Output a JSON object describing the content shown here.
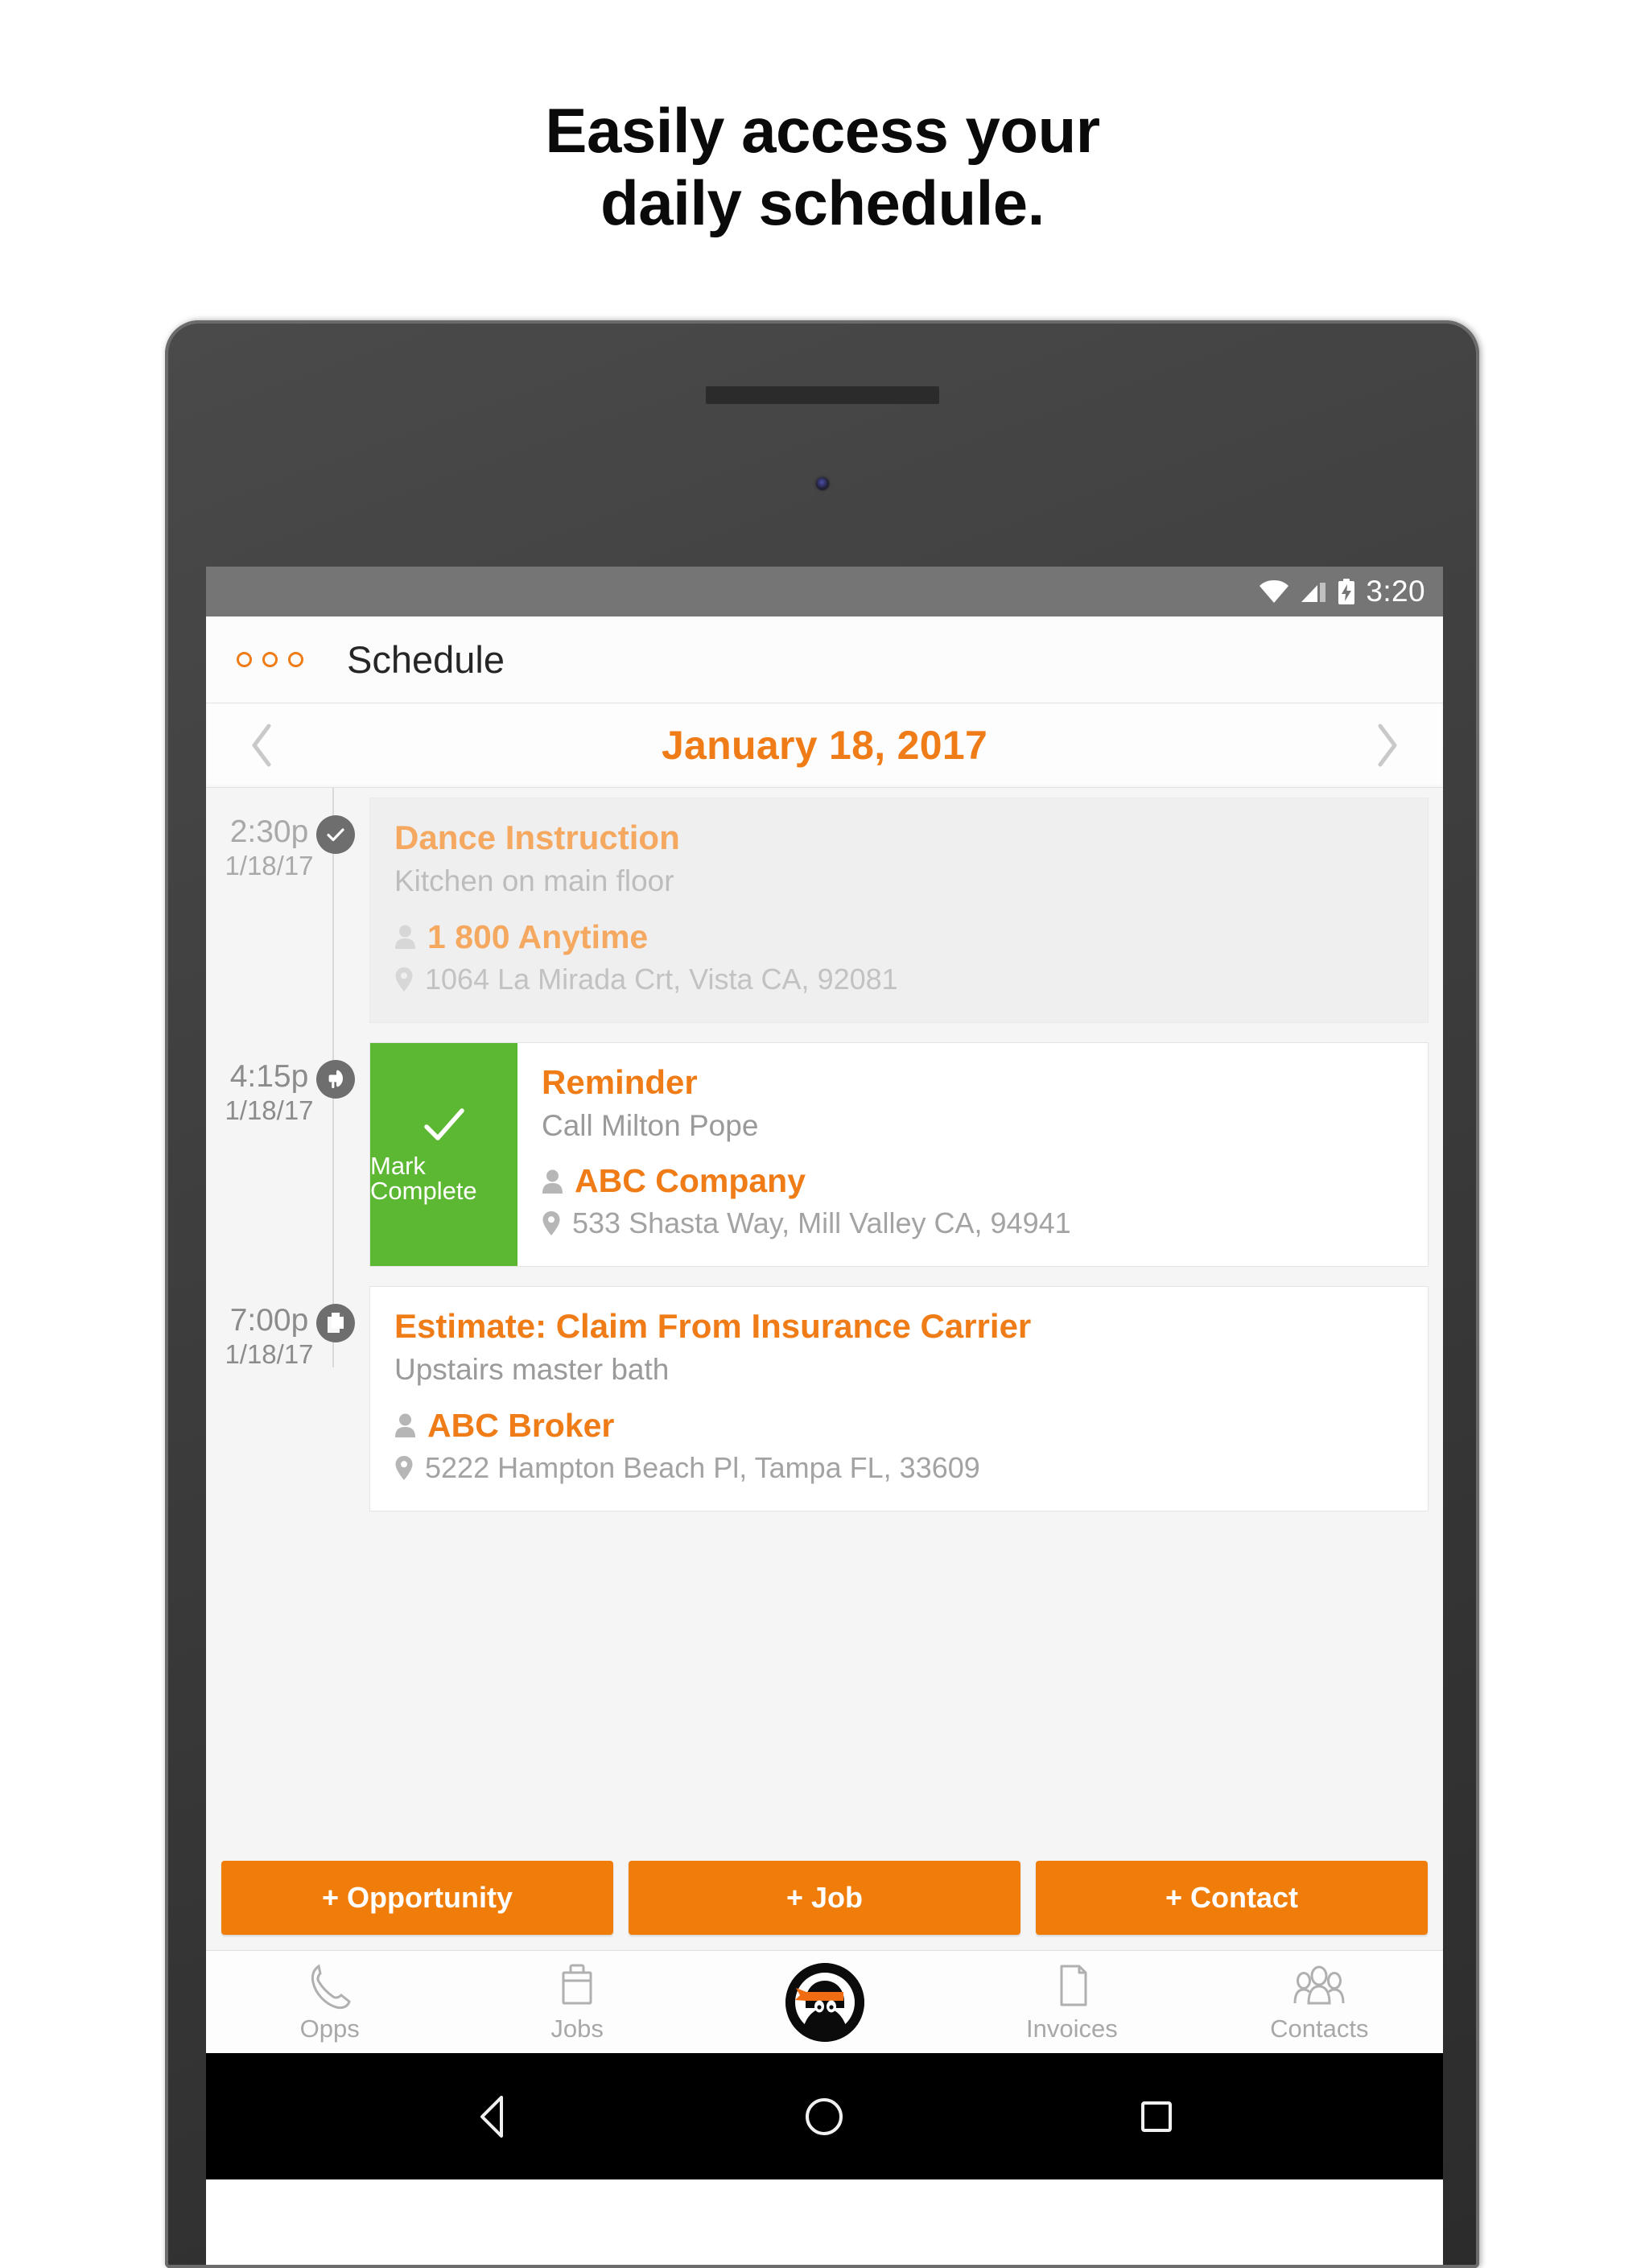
{
  "headline": {
    "line1": "Easily access your",
    "line2": "daily schedule."
  },
  "status_bar": {
    "time": "3:20",
    "icons": [
      "wifi-icon",
      "cellular-signal-icon",
      "battery-charging-icon"
    ]
  },
  "app_bar": {
    "menu_icon": "three-circles-menu-icon",
    "title": "Schedule"
  },
  "date_nav": {
    "prev_icon": "chevron-left-icon",
    "date": "January 18, 2017",
    "next_icon": "chevron-right-icon"
  },
  "events": [
    {
      "time": "2:30p",
      "date": "1/18/17",
      "badge_icon": "check-icon",
      "title": "Dance Instruction",
      "subtitle": "Kitchen on main floor",
      "company": "1 800 Anytime",
      "address": "1064 La Mirada Crt, Vista CA, 92081",
      "state": "completed"
    },
    {
      "time": "4:15p",
      "date": "1/18/17",
      "badge_icon": "megaphone-icon",
      "title": "Reminder",
      "subtitle": "Call Milton Pope",
      "company": "ABC Company",
      "address": "533 Shasta Way, Mill Valley CA, 94941",
      "state": "swiped",
      "swipe_action_label": "Mark Complete",
      "swipe_action_icon": "check-icon",
      "swipe_action_color": "#5CB832"
    },
    {
      "time": "7:00p",
      "date": "1/18/17",
      "badge_icon": "document-icon",
      "title": "Estimate: Claim From Insurance Carrier",
      "subtitle": "Upstairs master bath",
      "company": "ABC Broker",
      "address": "5222 Hampton Beach Pl, Tampa FL, 33609",
      "state": "default"
    }
  ],
  "cta_buttons": [
    {
      "label": "+ Opportunity"
    },
    {
      "label": "+ Job"
    },
    {
      "label": "+ Contact"
    }
  ],
  "tab_bar": [
    {
      "label": "Opps",
      "icon": "phone-icon"
    },
    {
      "label": "Jobs",
      "icon": "briefcase-icon"
    },
    {
      "label": "",
      "icon": "ninja-logo-icon"
    },
    {
      "label": "Invoices",
      "icon": "document-icon"
    },
    {
      "label": "Contacts",
      "icon": "people-icon"
    }
  ],
  "android_nav": {
    "back": "back-triangle-icon",
    "home": "home-circle-icon",
    "recents": "recents-square-icon"
  },
  "colors": {
    "accent_orange": "#EF7C17",
    "button_orange": "#F07D0A",
    "complete_green": "#5CB832",
    "status_bar_gray": "#757575",
    "badge_gray": "#6E6E6E"
  }
}
